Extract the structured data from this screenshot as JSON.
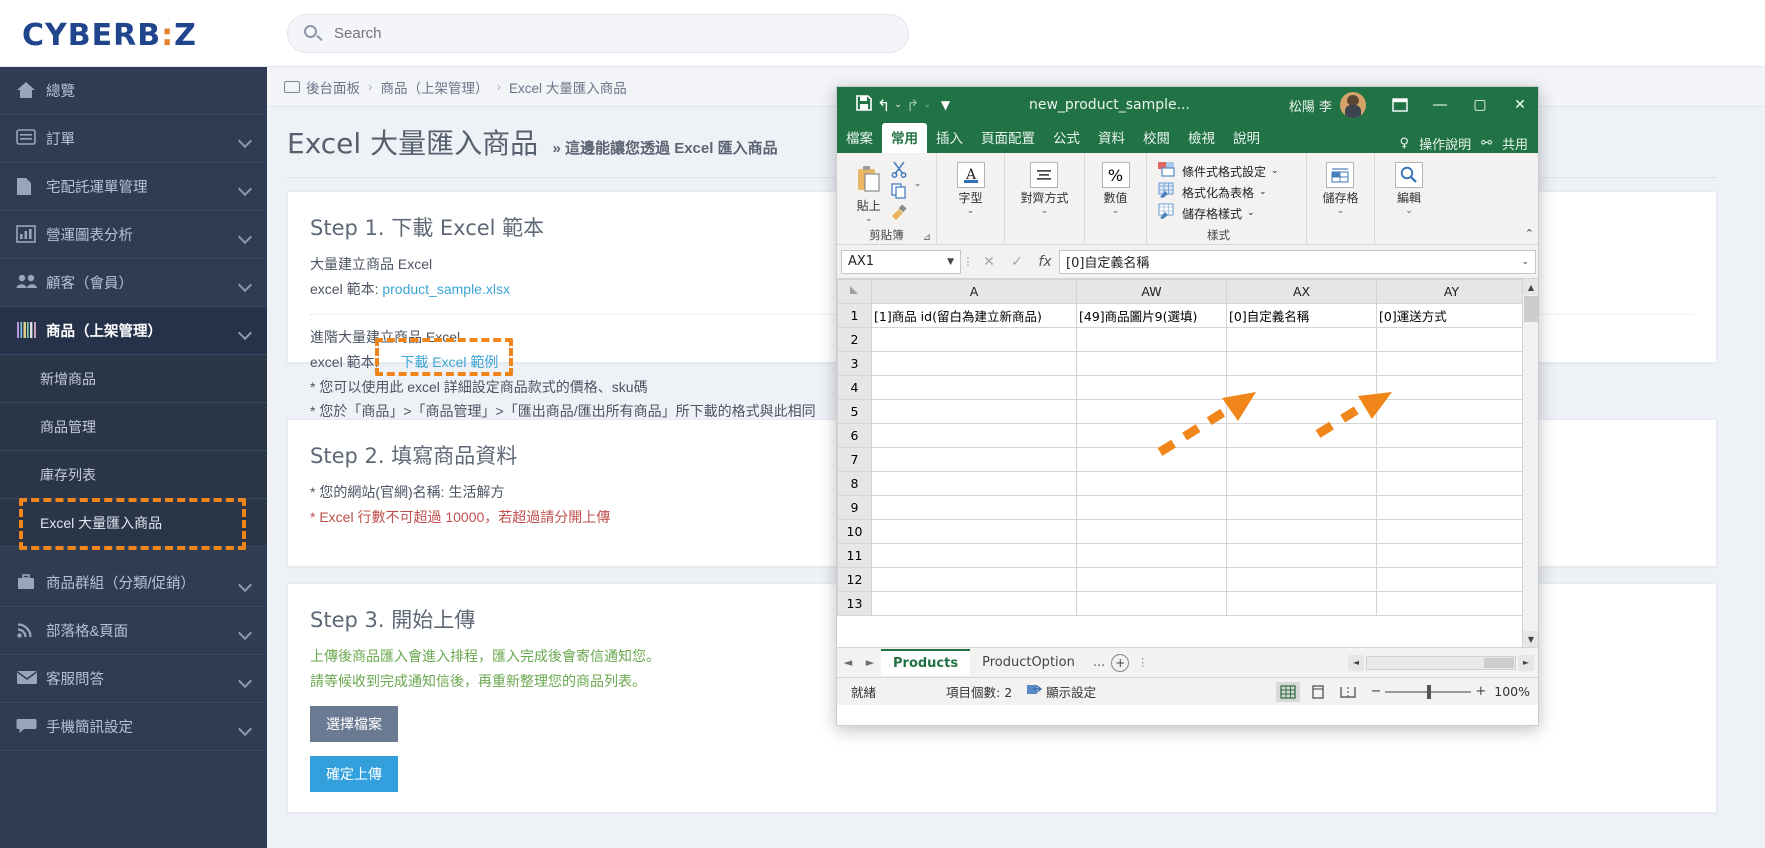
{
  "brand": {
    "name": "CYBERB",
    "dots": ":",
    "suffix": "Z"
  },
  "search": {
    "placeholder": "Search",
    "value": ""
  },
  "sidebar": {
    "items": [
      {
        "label": "總覽",
        "icon": "home-icon",
        "expandable": false
      },
      {
        "label": "訂單",
        "icon": "list-icon",
        "expandable": true
      },
      {
        "label": "宅配託運單管理",
        "icon": "doc-icon",
        "expandable": true
      },
      {
        "label": "營運圖表分析",
        "icon": "chart-icon",
        "expandable": true
      },
      {
        "label": "顧客（會員）",
        "icon": "users-icon",
        "expandable": true
      },
      {
        "label": "商品（上架管理）",
        "icon": "barcode-icon",
        "expandable": true,
        "active": true
      },
      {
        "label": "商品群組（分類/促銷）",
        "icon": "briefcase-icon",
        "expandable": true
      },
      {
        "label": "部落格&頁面",
        "icon": "rss-icon",
        "expandable": true
      },
      {
        "label": "客服問答",
        "icon": "envelope-icon",
        "expandable": true
      },
      {
        "label": "手機簡訊設定",
        "icon": "chat-icon",
        "expandable": true
      }
    ],
    "sub_items": [
      {
        "label": "新增商品"
      },
      {
        "label": "商品管理"
      },
      {
        "label": "庫存列表"
      },
      {
        "label": "Excel 大量匯入商品",
        "highlighted": true
      }
    ]
  },
  "breadcrumb": {
    "icon": "panel-icon",
    "items": [
      "後台面板",
      "商品（上架管理）",
      "Excel 大量匯入商品"
    ],
    "separator": "›"
  },
  "page": {
    "title": "Excel 大量匯入商品",
    "subtitle": "» 這邊能讓您透過 Excel 匯入商品"
  },
  "step1": {
    "heading": "Step 1. 下載 Excel 範本",
    "line1": "大量建立商品 Excel",
    "line2_label": "excel 範本:",
    "line2_link": "product_sample.xlsx",
    "line3": "進階大量建立商品 Excel",
    "line4_label": "excel 範本:",
    "line4_link": "下載 Excel 範例",
    "note1": "* 您可以使用此 excel 詳細設定商品款式的價格、sku碼",
    "note2": "* 您於「商品」>「商品管理」>「匯出商品/匯出所有商品」所下載的格式與此相同"
  },
  "step2": {
    "heading": "Step 2. 填寫商品資料",
    "note1": "* 您的網站(官網)名稱: 生活解方",
    "note2": "* Excel 行數不可超過 10000，若超過請分開上傳"
  },
  "step3": {
    "heading": "Step 3. 開始上傳",
    "note1": "上傳後商品匯入會進入排程，匯入完成後會寄信通知您。",
    "note2": "請等候收到完成通知信後，再重新整理您的商品列表。",
    "btn_choose": "選擇檔案",
    "btn_upload": "確定上傳"
  },
  "excel": {
    "filename": "new_product_sample...",
    "user": "松陽 李",
    "quick_access": [
      "save-icon",
      "undo-icon",
      "redo-icon",
      "customize-icon"
    ],
    "window_buttons": [
      "restore-icon",
      "minimize-icon",
      "maximize-icon",
      "close-icon"
    ],
    "ribbon_tabs": [
      "檔案",
      "常用",
      "插入",
      "頁面配置",
      "公式",
      "資料",
      "校閱",
      "檢視",
      "說明"
    ],
    "ribbon_active_tab": "常用",
    "tell_me": "操作說明",
    "share": "共用",
    "groups": [
      {
        "name": "剪貼簿",
        "big": "貼上",
        "small": [
          "剪下",
          "複製",
          "複製格式"
        ]
      },
      {
        "name": "",
        "big": "字型"
      },
      {
        "name": "",
        "big": "對齊方式"
      },
      {
        "name": "",
        "big": "數值"
      },
      {
        "name": "樣式",
        "items": [
          "條件式格式設定",
          "格式化為表格",
          "儲存格樣式"
        ]
      },
      {
        "name": "",
        "big": "儲存格"
      },
      {
        "name": "",
        "big": "編輯"
      }
    ],
    "namebox": "AX1",
    "formula": "[0]自定義名稱",
    "columns": [
      "A",
      "AW",
      "AX",
      "AY"
    ],
    "rows": [
      "1",
      "2",
      "3",
      "4",
      "5",
      "6",
      "7",
      "8",
      "9",
      "10",
      "11",
      "12",
      "13"
    ],
    "row1": [
      "[1]商品 id(留白為建立新商品)",
      "[49]商品圖片9(選填)",
      "[0]自定義名稱",
      "[0]運送方式"
    ],
    "sheets": [
      {
        "label": "Products",
        "active": true
      },
      {
        "label": "ProductOption",
        "active": false
      }
    ],
    "sheet_more": "...",
    "add_sheet": "+",
    "status": "就緒",
    "count_label": "項目個數: 2",
    "display_settings": "顯示設定",
    "zoom": "100%"
  },
  "colors": {
    "brand_blue": "#20458c",
    "brand_orange": "#e8812e",
    "highlight_orange": "#f08519",
    "excel_green": "#217346",
    "link_blue": "#3ca5d6",
    "btn_blue": "#31a0dc",
    "btn_grey": "#6a7a92",
    "red_note": "#c0504d",
    "green_note": "#6aa84f"
  }
}
